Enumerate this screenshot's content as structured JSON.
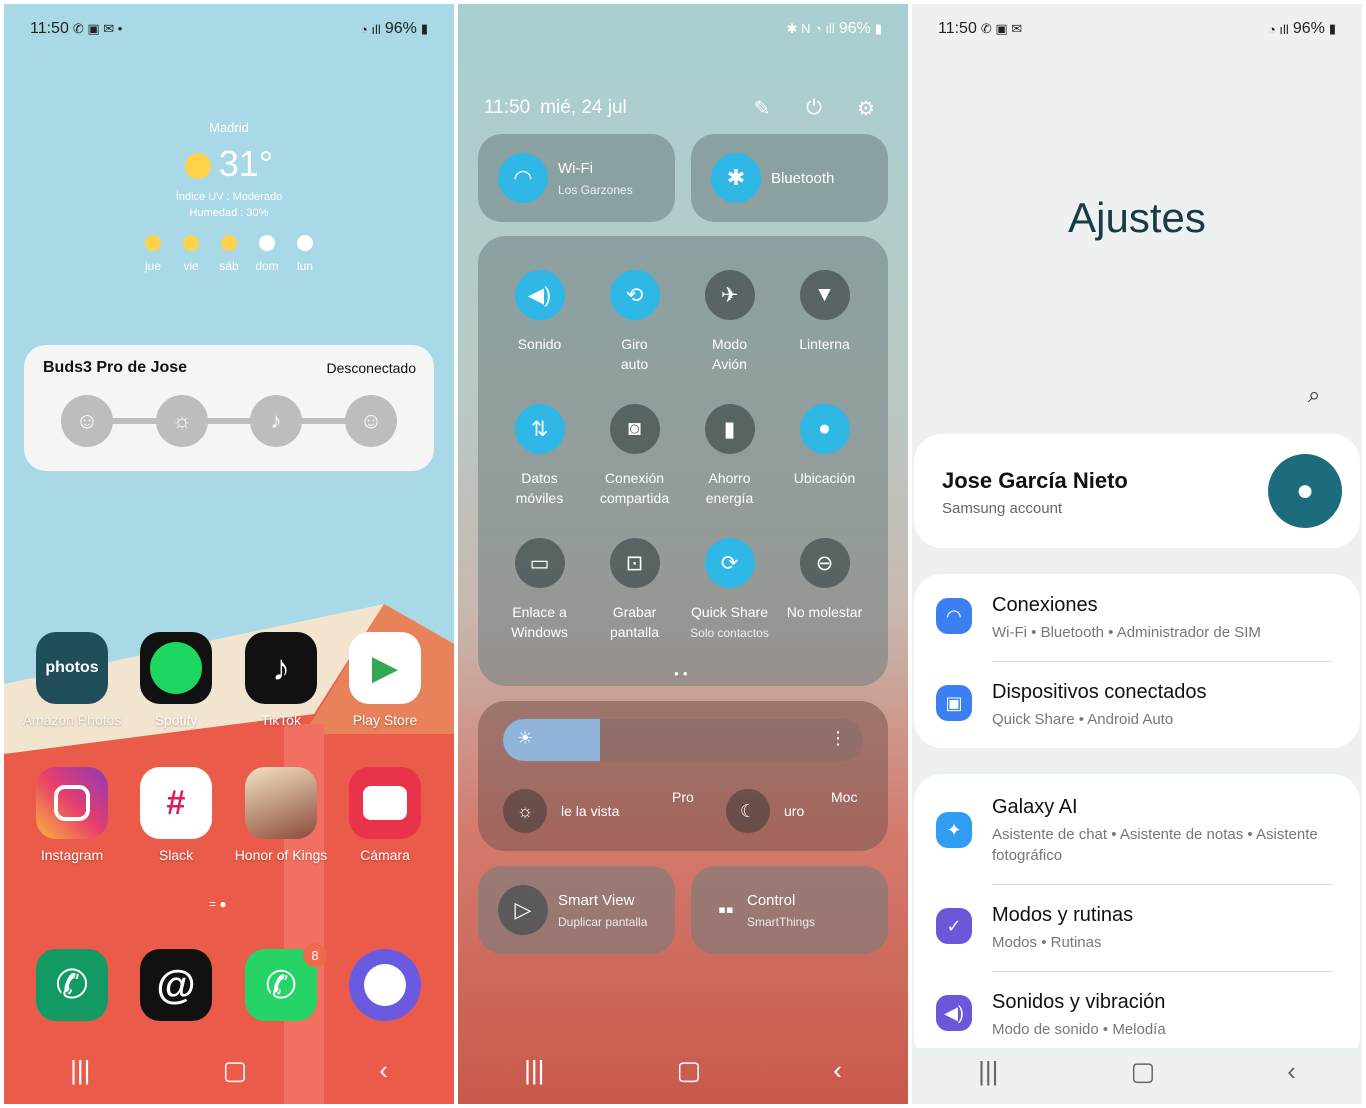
{
  "home": {
    "status": {
      "time": "11:50",
      "battery": "96%"
    },
    "weather": {
      "city": "Madrid",
      "temp": "31°",
      "uv": "Índice UV : Moderado",
      "humidity": "Humedad : 30%",
      "days": [
        "jue",
        "vie",
        "sáb",
        "dom",
        "lun"
      ]
    },
    "buds": {
      "name": "Buds3 Pro de Jose",
      "state": "Desconectado"
    },
    "apps": {
      "amazon_icon": "photos",
      "amazon": "Amazon Photos",
      "spotify": "Spotify",
      "tiktok": "TikTok",
      "playstore": "Play Store",
      "instagram": "Instagram",
      "slack": "Slack",
      "honor": "Honor of Kings",
      "camara": "Cámara"
    },
    "whatsapp_badge": "8"
  },
  "quick": {
    "status": {
      "battery": "96%"
    },
    "header": {
      "time": "11:50",
      "date": "mié, 24 jul"
    },
    "wifi": {
      "label": "Wi-Fi",
      "sub": "Los Garzones"
    },
    "bluetooth": {
      "label": "Bluetooth"
    },
    "tiles": {
      "sonido": "Sonido",
      "giro1": "Giro",
      "giro2": "auto",
      "avion1": "Modo",
      "avion2": "Avión",
      "linterna": "Linterna",
      "datos1": "Datos",
      "datos2": "móviles",
      "conexion1": "Conexión",
      "conexion2": "compartida",
      "ahorro1": "Ahorro",
      "ahorro2": "energía",
      "ubicacion": "Ubicación",
      "enlace1": "Enlace a",
      "enlace2": "Windows",
      "grabar1": "Grabar",
      "grabar2": "pantalla",
      "quickshare": "Quick Share",
      "quickshare_sub": "Solo contactos",
      "molestar": "No molestar"
    },
    "brightness": {
      "level": 0.27,
      "opt1": "le la vista",
      "opt2": "Pro",
      "opt3": "uro",
      "opt4": "Moc"
    },
    "smartview": {
      "label": "Smart View",
      "sub": "Duplicar pantalla"
    },
    "control": {
      "label": "Control",
      "sub": "SmartThings"
    }
  },
  "settings": {
    "status": {
      "time": "11:50",
      "battery": "96%"
    },
    "title": "Ajustes",
    "account": {
      "name": "Jose García Nieto",
      "sub": "Samsung account"
    },
    "rows": [
      {
        "title": "Conexiones",
        "sub": "Wi-Fi  •  Bluetooth  •  Administrador de SIM",
        "color": "#3b7ff2"
      },
      {
        "title": "Dispositivos conectados",
        "sub": "Quick Share  •  Android Auto",
        "color": "#3b7ff2"
      },
      {
        "title": "Galaxy AI",
        "sub": "Asistente de chat  •  Asistente de notas  •  Asistente fotográfico",
        "color": "#2f9df2"
      },
      {
        "title": "Modos y rutinas",
        "sub": "Modos  •  Rutinas",
        "color": "#6b57d9"
      },
      {
        "title": "Sonidos y vibración",
        "sub": "Modo de sonido  •  Melodía",
        "color": "#6b57d9"
      }
    ]
  }
}
